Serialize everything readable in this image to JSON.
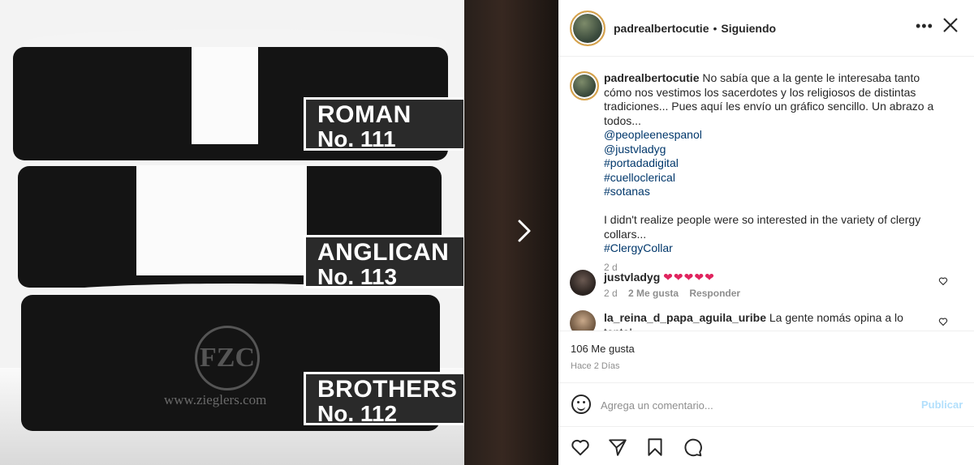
{
  "media": {
    "labels": [
      {
        "line1": "ROMAN",
        "line2": "No. 111"
      },
      {
        "line1": "ANGLICAN",
        "line2": "No. 113"
      },
      {
        "line1": "BROTHERS",
        "line2": "No. 112"
      }
    ],
    "watermark": "www.zieglers.com",
    "logo_text": "FZC"
  },
  "header": {
    "username": "padrealbertocutie",
    "separator": "•",
    "follow_status": "Siguiendo",
    "more_label": "•••",
    "close_label": "✕"
  },
  "caption": {
    "username": "padrealbertocutie",
    "text_es": "No sabía que a la gente le interesaba tanto cómo nos vestimos los sacerdotes y los religiosos de distintas tradiciones... Pues aquí les envío un gráfico sencillo. Un abrazo a todos...",
    "mentions": [
      "@peopleenespanol",
      "@justvladyg"
    ],
    "hashtags_es": [
      "#portadadigital",
      "#cuelloclerical",
      "#sotanas"
    ],
    "text_en": "I didn't realize people were so interested in the variety of clergy collars...",
    "hashtag_en": "#ClergyCollar",
    "time": "2 d"
  },
  "comments": [
    {
      "username": "justvladyg",
      "text": "❤❤❤❤❤",
      "time": "2 d",
      "likes": "2 Me gusta",
      "reply": "Responder"
    },
    {
      "username": "la_reina_d_papa_aguila_uribe",
      "text": "La gente nomás opina a lo tonto!"
    }
  ],
  "stats": {
    "likes": "106 Me gusta",
    "ago": "Hace 2 Días"
  },
  "composer": {
    "placeholder": "Agrega un comentario...",
    "publish": "Publicar"
  },
  "colors": {
    "link": "#00376b",
    "publish_disabled": "#b2dffc",
    "heart": "#e0245e"
  }
}
